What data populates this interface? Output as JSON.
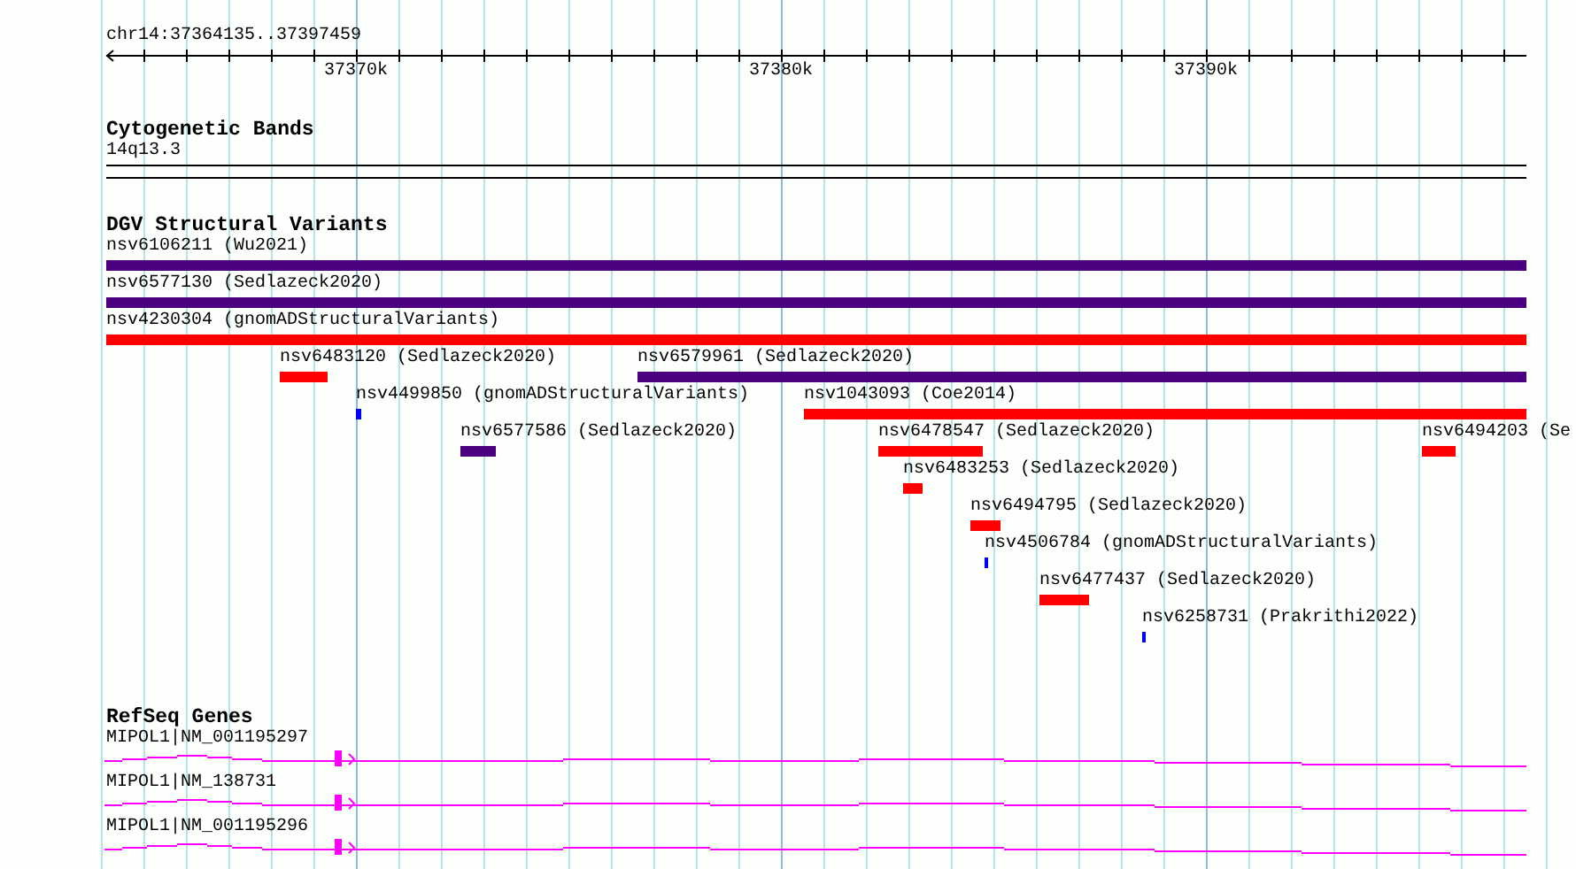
{
  "ruler": {
    "location": "chr14:37364135..37397459",
    "tick_labels": [
      "37370k",
      "37380k",
      "37390k"
    ]
  },
  "cytogenetic_bands": {
    "title": "Cytogenetic Bands",
    "band": "14q13.3"
  },
  "structural_variants": {
    "title": "DGV Structural Variants",
    "items": [
      {
        "label": "nsv6106211 (Wu2021)",
        "color": "#4b0082"
      },
      {
        "label": "nsv6577130 (Sedlazeck2020)",
        "color": "#4b0082"
      },
      {
        "label": "nsv4230304 (gnomADStructuralVariants)",
        "color": "#ff0000"
      },
      {
        "label": "nsv6483120 (Sedlazeck2020)",
        "color": "#ff0000"
      },
      {
        "label": "nsv6579961 (Sedlazeck2020)",
        "color": "#4b0082"
      },
      {
        "label": "nsv4499850 (gnomADStructuralVariants)",
        "color": "#0000ff"
      },
      {
        "label": "nsv1043093 (Coe2014)",
        "color": "#ff0000"
      },
      {
        "label": "nsv6577586 (Sedlazeck2020)",
        "color": "#4b0082"
      },
      {
        "label": "nsv6478547 (Sedlazeck2020)",
        "color": "#ff0000"
      },
      {
        "label": "nsv6494203 (Se",
        "color": "#ff0000"
      },
      {
        "label": "nsv6483253 (Sedlazeck2020)",
        "color": "#ff0000"
      },
      {
        "label": "nsv6494795 (Sedlazeck2020)",
        "color": "#ff0000"
      },
      {
        "label": "nsv4506784 (gnomADStructuralVariants)",
        "color": "#0000ff"
      },
      {
        "label": "nsv6477437 (Sedlazeck2020)",
        "color": "#ff0000"
      },
      {
        "label": "nsv6258731 (Prakrithi2022)",
        "color": "#0000ff"
      }
    ]
  },
  "refseq_genes": {
    "title": "RefSeq Genes",
    "items": [
      {
        "label": "MIPOL1|NM_001195297"
      },
      {
        "label": "MIPOL1|NM_138731"
      },
      {
        "label": "MIPOL1|NM_001195296"
      }
    ]
  }
}
